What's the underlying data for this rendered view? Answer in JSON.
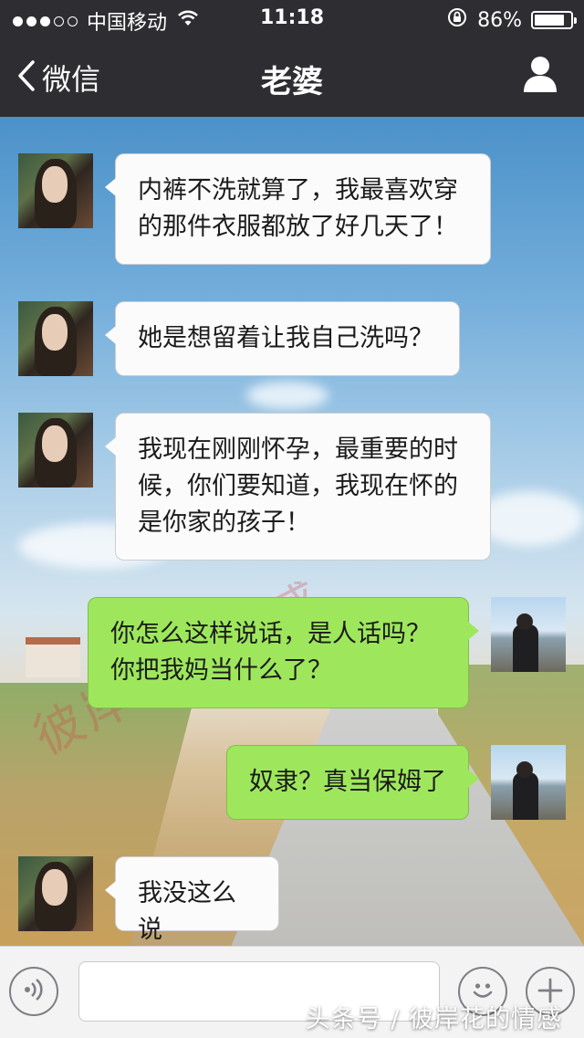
{
  "status_bar": {
    "carrier": "中国移动",
    "time": "11:18",
    "battery": "86%",
    "battery_level": 0.86
  },
  "nav": {
    "back_label": "微信",
    "title": "老婆"
  },
  "watermark": "彼岸花的情感",
  "messages": [
    {
      "sender": "wife",
      "text": "内裤不洗就算了，我最喜欢穿的那件衣服都放了好几天了！"
    },
    {
      "sender": "wife",
      "text": "她是想留着让我自己洗吗？"
    },
    {
      "sender": "wife",
      "text": "我现在刚刚怀孕，最重要的时候，你们要知道，我现在怀的是你家的孩子！"
    },
    {
      "sender": "me",
      "text": "你怎么这样说话，是人话吗？你把我妈当什么了？"
    },
    {
      "sender": "me",
      "text": "奴隶？真当保姆了"
    },
    {
      "sender": "wife",
      "text": "我没这么说"
    }
  ],
  "footer": {
    "source": "头条号 / 彼岸花的情感"
  },
  "icons": {
    "back": "chevron-left-icon",
    "profile": "person-icon",
    "voice": "voice-icon",
    "emoji": "emoji-icon",
    "plus": "plus-icon"
  }
}
